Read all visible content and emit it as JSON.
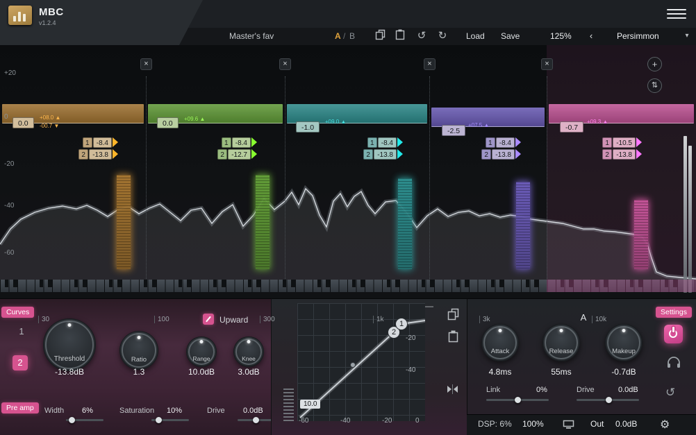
{
  "colors": {
    "accent": "#d6538f"
  },
  "app": {
    "title": "MBC",
    "version": "v1.2.4"
  },
  "toolbar": {
    "preset": "Master's fav",
    "ab_a": "A",
    "ab_sep": "/",
    "ab_b": "B",
    "load": "Load",
    "save": "Save",
    "zoom": "125%",
    "theme": "Persimmon"
  },
  "icons": {
    "undo": "↺",
    "redo": "↻",
    "prev": "‹",
    "dropdown": "▾",
    "close": "×",
    "add": "+",
    "scale": "⇅",
    "gear": "⚙",
    "sync": "↺",
    "minimize": "—"
  },
  "spectrum": {
    "db_labels": [
      "+20",
      "0",
      "-20",
      "-40",
      "-60"
    ],
    "freq_labels": [
      "30",
      "100",
      "300",
      "1k",
      "3k",
      "10k"
    ]
  },
  "bands": [
    {
      "color": "#ab7a33",
      "gain": "0.0",
      "up": "+08.0 ▲",
      "down": "-00.7 ▼",
      "n1": "1",
      "t1": "-8.4",
      "n2": "2",
      "t2": "-13.8"
    },
    {
      "color": "#67a53a",
      "gain": "0.0",
      "up": "+09.6 ▲",
      "down": "",
      "n1": "1",
      "t1": "-8.4",
      "n2": "2",
      "t2": "-12.7"
    },
    {
      "color": "#2f9494",
      "gain": "-1.0",
      "up": "+09.0 ▲",
      "down": "",
      "n1": "1",
      "t1": "-8.4",
      "n2": "2",
      "t2": "-13.8"
    },
    {
      "color": "#6f5fc0",
      "gain": "-2.5",
      "up": "+07.5 ▲",
      "down": "",
      "n1": "1",
      "t1": "-8.4",
      "n2": "2",
      "t2": "-13.8"
    },
    {
      "color": "#cb579d",
      "gain": "-0.7",
      "up": "+09.3 ▲",
      "down": "",
      "n1": "1",
      "t1": "-10.5",
      "n2": "2",
      "t2": "-13.8"
    }
  ],
  "curves": {
    "badge": "Curves",
    "band_buttons": [
      "1",
      "2"
    ],
    "upward": "Upward",
    "knobs": [
      {
        "label": "Threshold",
        "value": "-13.8dB"
      },
      {
        "label": "Ratio",
        "value": "1.3"
      },
      {
        "label": "Range",
        "value": "10.0dB"
      },
      {
        "label": "Knee",
        "value": "3.0dB"
      }
    ]
  },
  "preamp": {
    "badge": "Pre amp",
    "params": [
      {
        "label": "Width",
        "value": "6%"
      },
      {
        "label": "Saturation",
        "value": "10%"
      },
      {
        "label": "Drive",
        "value": "0.0dB"
      }
    ]
  },
  "graph": {
    "x_labels": [
      "-60",
      "-40",
      "-20",
      "0"
    ],
    "y_labels": [
      "-20",
      "-40"
    ],
    "readout": "10.0",
    "point1": "1",
    "point2": "2"
  },
  "dynamics": {
    "variant": "A",
    "knobs": [
      {
        "label": "Attack",
        "value": "4.8ms"
      },
      {
        "label": "Release",
        "value": "55ms"
      },
      {
        "label": "Makeup",
        "value": "-0.7dB"
      }
    ],
    "sliders": [
      {
        "label": "Link",
        "value": "0%"
      },
      {
        "label": "Drive",
        "value": "0.0dB"
      }
    ]
  },
  "settings_badge": "Settings",
  "statusbar": {
    "dsp": "DSP: 6%",
    "ui_scale": "100%",
    "out_label": "Out",
    "out_value": "0.0dB"
  }
}
